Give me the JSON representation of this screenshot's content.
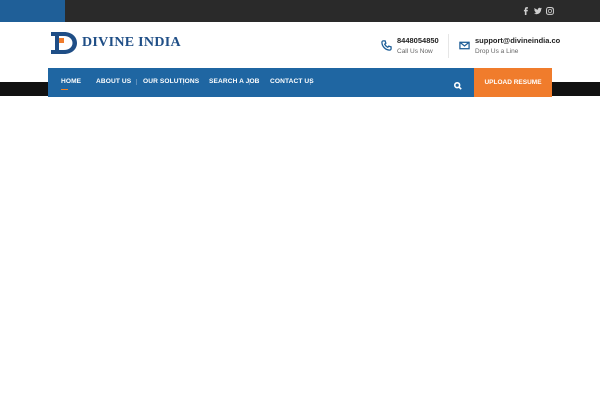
{
  "social": [
    {
      "icon": "facebook-icon"
    },
    {
      "icon": "twitter-icon"
    },
    {
      "icon": "instagram-icon"
    }
  ],
  "brand": {
    "name": "DIVINE INDIA",
    "colors": {
      "primary": "#1f66a2",
      "accent": "#f07c2c",
      "dark": "#2a2a2a"
    }
  },
  "contact": {
    "phone": {
      "icon": "phone-icon",
      "main": "8448054850",
      "sub": "Call Us Now"
    },
    "email": {
      "icon": "envelope-icon",
      "main": "support@divineindia.co",
      "sub": "Drop Us a Line"
    }
  },
  "nav": {
    "items": [
      {
        "label": "HOME",
        "active": true
      },
      {
        "label": "ABOUT US"
      },
      {
        "label": "OUR SOLUTIONS"
      },
      {
        "label": "SEARCH A JOB"
      },
      {
        "label": "CONTACT US"
      }
    ],
    "search_icon": "search-icon",
    "cta_label": "UPLOAD RESUME"
  }
}
